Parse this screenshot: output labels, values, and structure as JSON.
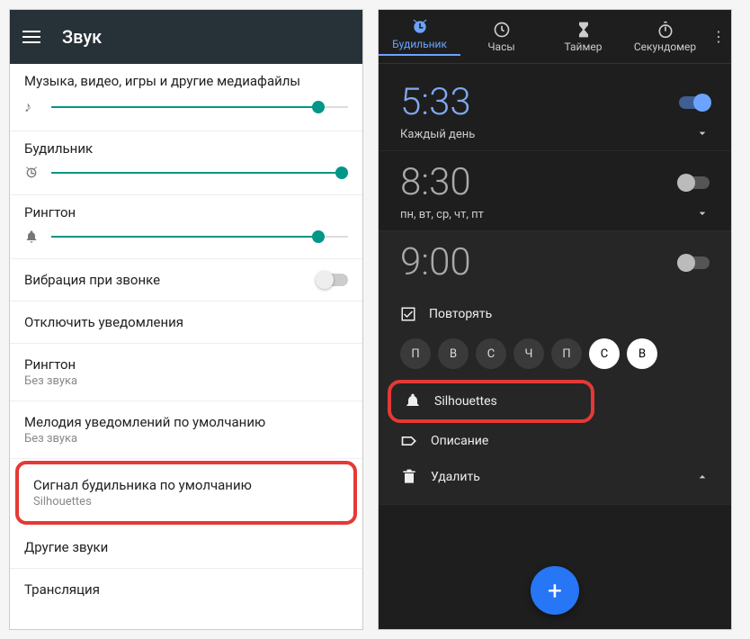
{
  "left": {
    "title": "Звук",
    "sliders": [
      {
        "label": "Музыка, видео, игры и другие медиафайлы",
        "icon": "music-note",
        "value": 90
      },
      {
        "label": "Будильник",
        "icon": "alarm",
        "value": 98
      },
      {
        "label": "Рингтон",
        "icon": "bell",
        "value": 90
      }
    ],
    "vibrate": {
      "label": "Вибрация при звонке",
      "on": false
    },
    "items": [
      {
        "label": "Отключить уведомления"
      },
      {
        "label": "Рингтон",
        "sub": "Без звука"
      },
      {
        "label": "Мелодия уведомлений по умолчанию",
        "sub": "Без звука"
      },
      {
        "label": "Сигнал будильника по умолчанию",
        "sub": "Silhouettes",
        "highlight": true
      },
      {
        "label": "Другие звуки"
      },
      {
        "label": "Трансляция"
      }
    ]
  },
  "right": {
    "tabs": [
      {
        "label": "Будильник",
        "icon": "alarm",
        "active": true
      },
      {
        "label": "Часы",
        "icon": "clock"
      },
      {
        "label": "Таймер",
        "icon": "hourglass"
      },
      {
        "label": "Секундомер",
        "icon": "stopwatch"
      }
    ],
    "alarms": [
      {
        "time": "5:33",
        "days": "Каждый день",
        "on": true
      },
      {
        "time": "8:30",
        "days": "пн, вт, ср, чт, пт",
        "on": false
      },
      {
        "time": "9:00",
        "on": false,
        "expanded": true,
        "repeat_label": "Повторять",
        "daypills": [
          "П",
          "В",
          "С",
          "Ч",
          "П",
          "С",
          "В"
        ],
        "selected": [
          5,
          6
        ],
        "ringtone": "Silhouettes",
        "desc": "Описание",
        "delete": "Удалить"
      }
    ]
  }
}
